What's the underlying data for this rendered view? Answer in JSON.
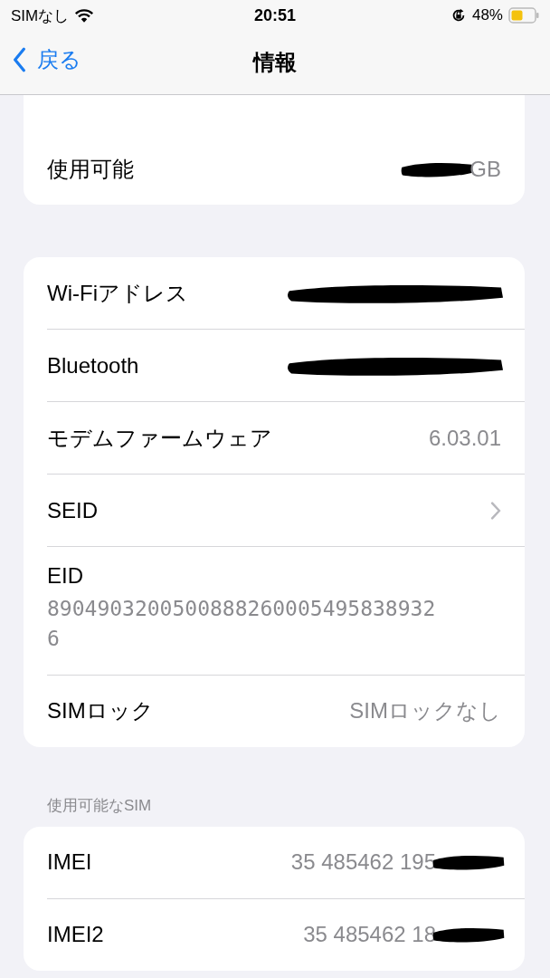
{
  "status_bar": {
    "carrier": "SIMなし",
    "time": "20:51",
    "battery": "48%"
  },
  "nav": {
    "back": "戻る",
    "title": "情報"
  },
  "sections": [
    {
      "rows": [
        {
          "kind": "value",
          "label": "使用可能",
          "value": "GB",
          "scribble_before": true
        }
      ]
    },
    {
      "rows": [
        {
          "kind": "value",
          "label": "Wi-Fiアドレス",
          "scribble": true
        },
        {
          "kind": "value",
          "label": "Bluetooth",
          "scribble": true
        },
        {
          "kind": "value",
          "label": "モデムファームウェア",
          "value": "6.03.01"
        },
        {
          "kind": "chevron",
          "label": "SEID"
        },
        {
          "kind": "stacked",
          "label": "EID",
          "value": "89049032005008882600054958389326"
        },
        {
          "kind": "value",
          "label": "SIMロック",
          "value": "SIMロックなし"
        }
      ]
    },
    {
      "header": "使用可能なSIM",
      "rows": [
        {
          "kind": "value",
          "label": "IMEI",
          "value": "35 485462 195",
          "scribble_after": true
        },
        {
          "kind": "value",
          "label": "IMEI2",
          "value": "35 485462 18",
          "scribble_after": true
        }
      ]
    }
  ]
}
